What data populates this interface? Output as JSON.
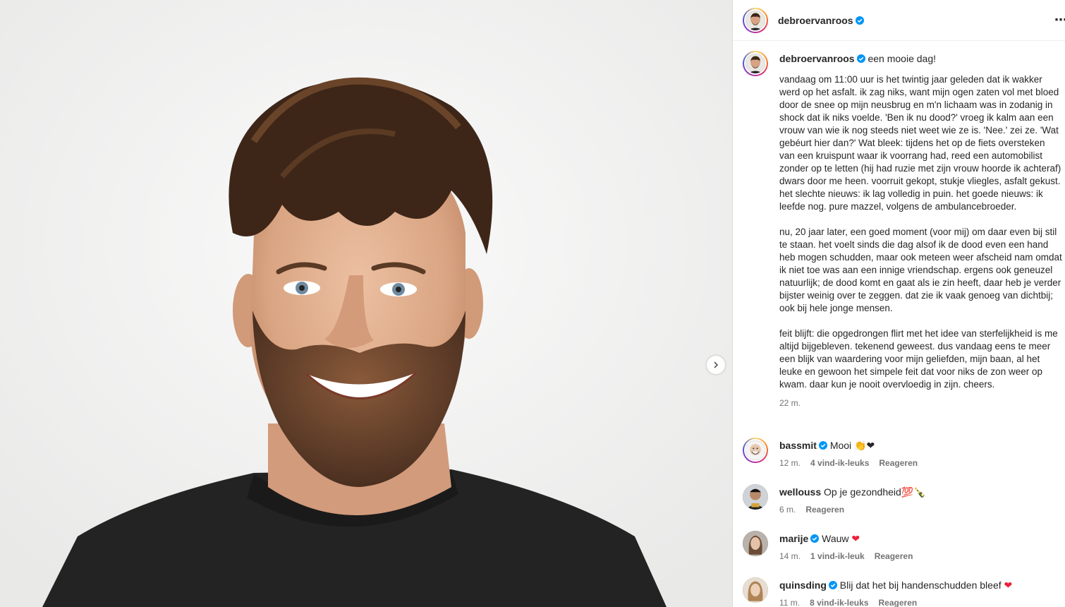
{
  "post": {
    "author": "debroervanroos",
    "caption_title": "een mooie dag!",
    "caption_body": "vandaag om 11:00 uur is het twintig jaar geleden dat ik wakker werd op het asfalt. ik zag niks, want mijn ogen zaten vol met bloed door de snee op mijn neusbrug en m'n lichaam was in zodanig in shock dat ik niks voelde. 'Ben ik nu dood?' vroeg ik kalm aan een vrouw van wie ik nog steeds niet weet wie ze is. 'Nee.' zei ze. 'Wat gebéurt hier dan?' Wat bleek: tijdens het op de fiets oversteken van een kruispunt waar ik voorrang had, reed een automobilist zonder op te letten (hij had ruzie met zijn vrouw hoorde ik achteraf) dwars door me heen. voorruit gekopt, stukje vliegles, asfalt gekust. het slechte nieuws: ik lag volledig in puin. het goede nieuws: ik leefde nog. pure mazzel, volgens de ambulancebroeder.\n\nnu, 20 jaar later, een goed moment (voor mij) om daar even bij stil te staan. het voelt sinds die dag alsof ik de dood even een hand heb mogen schudden, maar ook meteen weer afscheid nam omdat ik niet toe was aan een innige vriendschap. ergens ook geneuzel natuurlijk; de dood komt en gaat als ie zin heeft, daar heb je verder bijster weinig over te zeggen. dat zie ik vaak genoeg van dichtbij; ook bij hele jonge mensen.\n\nfeit blijft: die opgedrongen flirt met het idee van sterfelijkheid is me altijd bijgebleven. tekenend geweest. dus vandaag eens te meer een blijk van waardering voor mijn geliefden, mijn baan, al het leuke en gewoon het simpele feit dat voor niks de zon weer op kwam. daar kun je nooit overvloedig in zijn. cheers.",
    "time": "22 m."
  },
  "comments": [
    {
      "user": "bassmit",
      "verified": true,
      "text": "Mooi",
      "emoji": "👏❤",
      "time": "12 m.",
      "likes": "4 vind-ik-leuks",
      "reply": "Reageren"
    },
    {
      "user": "wellouss",
      "verified": false,
      "text": "Op je gezondheid",
      "emoji": "💯🍾",
      "time": "6 m.",
      "likes": "",
      "reply": "Reageren"
    },
    {
      "user": "marije",
      "verified": true,
      "text": "Wauw",
      "emoji": "❤",
      "time": "14 m.",
      "likes": "1 vind-ik-leuk",
      "reply": "Reageren"
    },
    {
      "user": "quinsding",
      "verified": true,
      "text": "Blij dat het bij handenschudden bleef",
      "emoji": "❤",
      "time": "11 m.",
      "likes": "8 vind-ik-leuks",
      "reply": "Reageren"
    }
  ],
  "icons": {
    "verified": "verified-badge-icon",
    "more": "more-options-icon",
    "next": "chevron-right-icon"
  },
  "colors": {
    "verified": "#0095f6",
    "heart": "#ed2038",
    "meta": "#737373"
  }
}
